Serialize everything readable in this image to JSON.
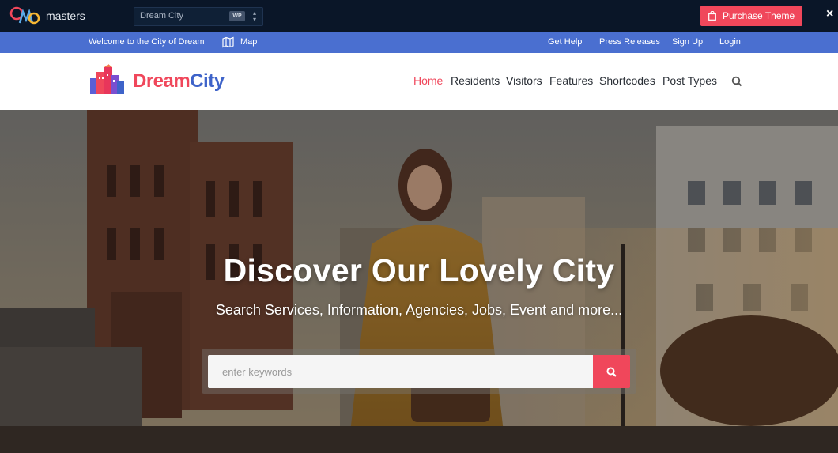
{
  "demo_bar": {
    "brand": "masters",
    "theme_select": {
      "value": "Dream City",
      "badge": "WP"
    },
    "purchase_label": "Purchase Theme",
    "close_label": "×"
  },
  "util_bar": {
    "welcome": "Welcome to the City of Dream",
    "map_label": "Map",
    "links": [
      "Get Help",
      "Press Releases",
      "Sign Up",
      "Login"
    ]
  },
  "header": {
    "brand_part1": "Dream",
    "brand_part2": "City",
    "nav": [
      "Home",
      "Residents",
      "Visitors",
      "Features",
      "Shortcodes",
      "Post Types"
    ],
    "active_nav": "Home"
  },
  "hero": {
    "title": "Discover Our Lovely City",
    "subtitle": "Search Services, Information, Agencies, Jobs, Event and more...",
    "search_placeholder": "enter keywords"
  },
  "colors": {
    "accent_red": "#f0475b",
    "brand_blue": "#3e63c9",
    "util_bar_blue": "#4a6fd0",
    "demo_bar_bg": "#0a1628"
  },
  "icons": {
    "purchase": "shopping-bag-icon",
    "map": "map-icon",
    "search": "search-icon",
    "close": "close-icon"
  }
}
